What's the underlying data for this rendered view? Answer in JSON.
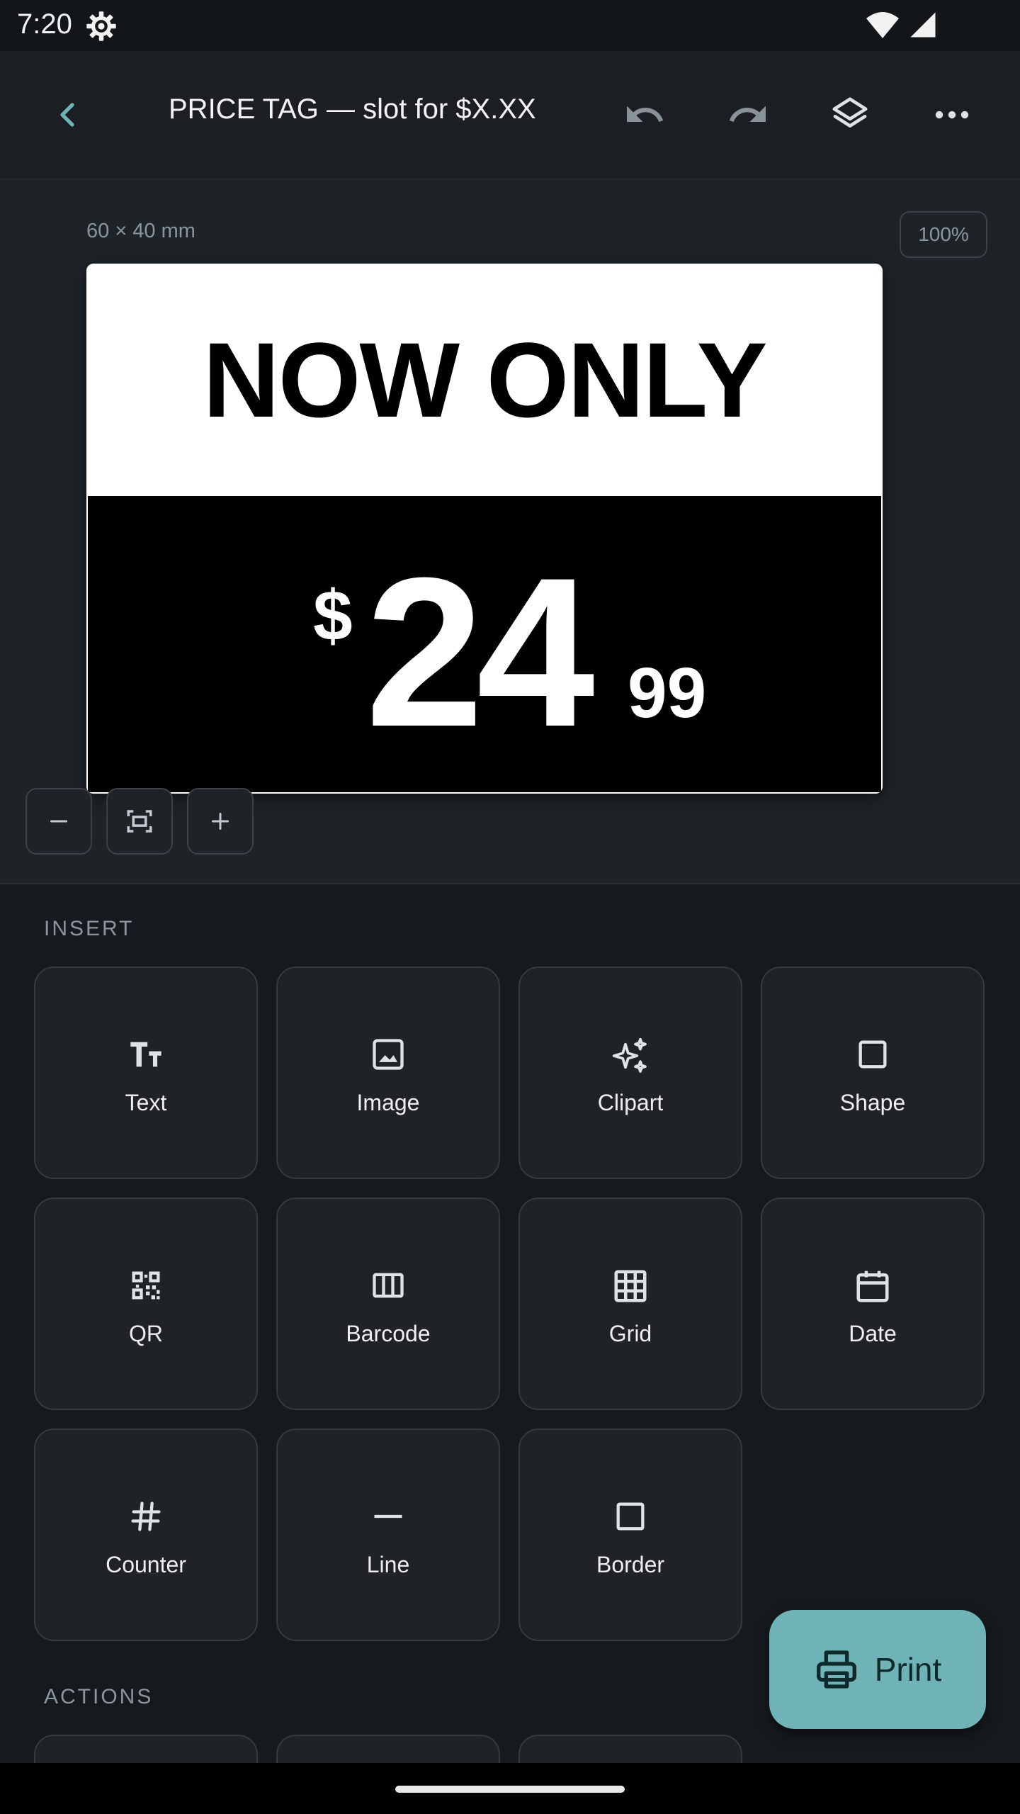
{
  "status_bar": {
    "time": "7:20",
    "icons": [
      "gear-icon",
      "wifi-icon",
      "signal-icon"
    ]
  },
  "app_bar": {
    "title": "PRICE TAG — slot for $X.XX",
    "icons": [
      "back-icon",
      "undo-icon",
      "redo-icon",
      "layers-icon",
      "more-icon"
    ],
    "accent_color": "#6fb3b6"
  },
  "canvas": {
    "dimensions": "60 × 40 mm",
    "zoom": "100%",
    "tag": {
      "headline": "NOW ONLY",
      "currency": "$",
      "price_main": "24",
      "price_cents": "99"
    },
    "zoom_controls": [
      "minus-icon",
      "fit-screen-icon",
      "plus-icon"
    ]
  },
  "insert": {
    "label": "INSERT",
    "items": [
      {
        "label": "Text",
        "icon": "text-icon"
      },
      {
        "label": "Image",
        "icon": "image-icon"
      },
      {
        "label": "Clipart",
        "icon": "sparkle-icon"
      },
      {
        "label": "Shape",
        "icon": "square-icon"
      },
      {
        "label": "QR",
        "icon": "qr-icon"
      },
      {
        "label": "Barcode",
        "icon": "barcode-icon"
      },
      {
        "label": "Grid",
        "icon": "grid-icon"
      },
      {
        "label": "Date",
        "icon": "calendar-icon"
      },
      {
        "label": "Counter",
        "icon": "hash-icon"
      },
      {
        "label": "Line",
        "icon": "line-icon"
      },
      {
        "label": "Border",
        "icon": "border-icon"
      }
    ]
  },
  "actions": {
    "label": "ACTIONS"
  },
  "print_button": {
    "label": "Print",
    "icon": "printer-icon",
    "color": "#6fb3b6"
  }
}
